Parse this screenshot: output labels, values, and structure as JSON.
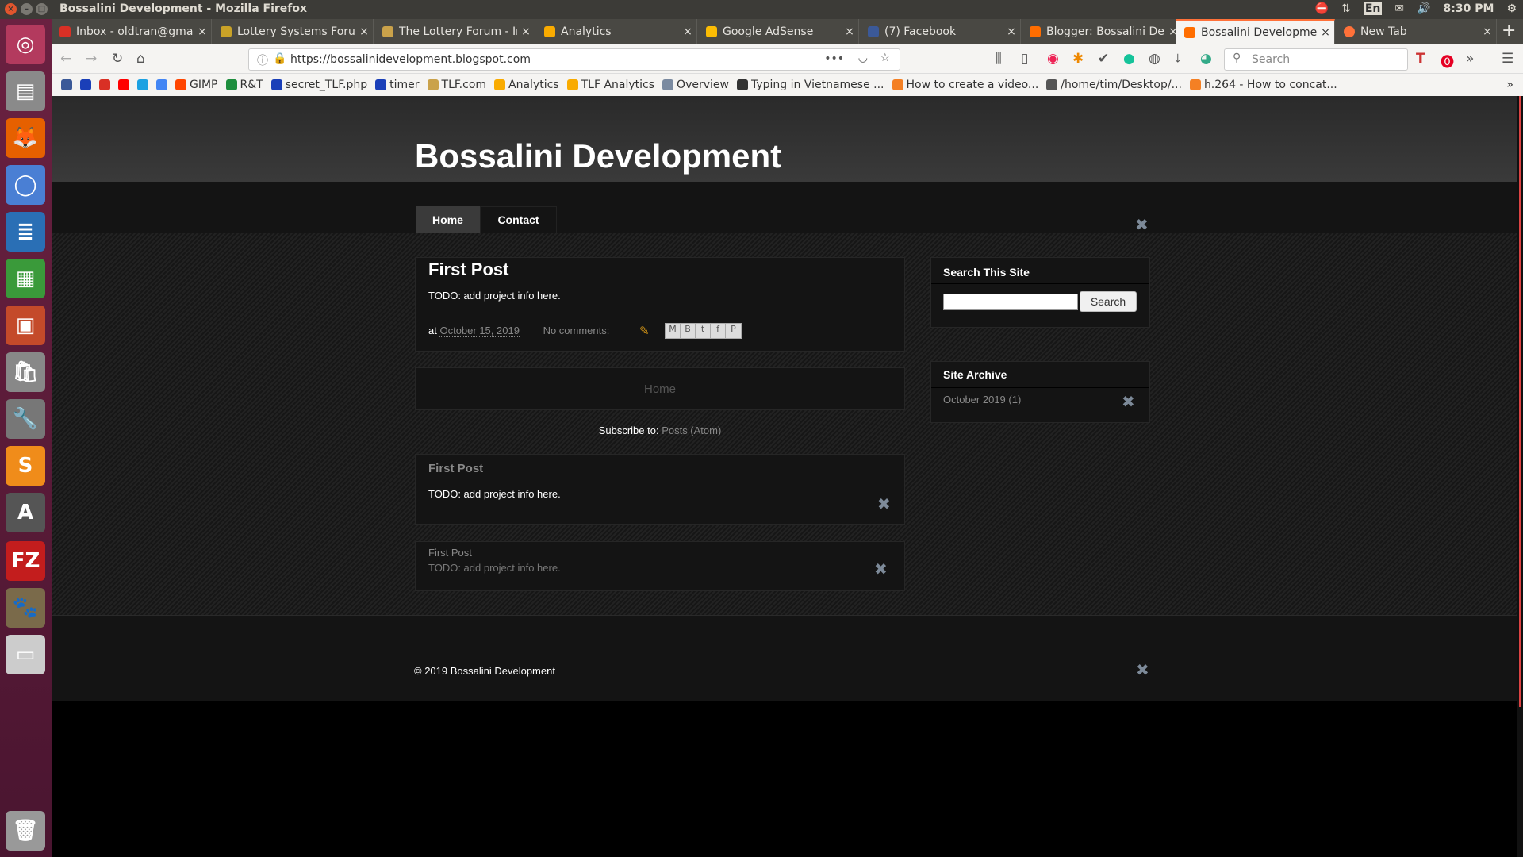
{
  "window": {
    "title": "Bossalini Development - Mozilla Firefox"
  },
  "tray": {
    "lang": "En",
    "time": "8:30 PM"
  },
  "tabs": [
    {
      "label": "Inbox - oldtran@gmail.com",
      "color": "#d93025"
    },
    {
      "label": "Lottery Systems Forum",
      "color": "#c9a227"
    },
    {
      "label": "The Lottery Forum - Index",
      "color": "#caa24a"
    },
    {
      "label": "Analytics",
      "color": "#f9ab00"
    },
    {
      "label": "Google AdSense",
      "color": "#fbbc04"
    },
    {
      "label": "(7) Facebook",
      "color": "#3b5998"
    },
    {
      "label": "Blogger: Bossalini Development",
      "color": "#ff6d00"
    },
    {
      "label": "Bossalini Development",
      "color": "#ff6d00"
    },
    {
      "label": "New Tab",
      "color": "#ff7139"
    }
  ],
  "address": {
    "url": "https://bossalinidevelopment.blogspot.com",
    "search_placeholder": "Search"
  },
  "bookmarks": [
    {
      "label": "",
      "color": "#3b5998"
    },
    {
      "label": "",
      "color": "#1a3fb8"
    },
    {
      "label": "",
      "color": "#d93025"
    },
    {
      "label": "",
      "color": "#ff0000"
    },
    {
      "label": "",
      "color": "#1ba1e2"
    },
    {
      "label": "",
      "color": "#4285f4"
    },
    {
      "label": "GIMP",
      "color": "#ff4500"
    },
    {
      "label": "R&T",
      "color": "#1e8e3e"
    },
    {
      "label": "secret_TLF.php",
      "color": "#1a3fb8"
    },
    {
      "label": "timer",
      "color": "#1a3fb8"
    },
    {
      "label": "TLF.com",
      "color": "#caa24a"
    },
    {
      "label": "Analytics",
      "color": "#f9ab00"
    },
    {
      "label": "TLF Analytics",
      "color": "#f9ab00"
    },
    {
      "label": "Overview",
      "color": "#7a8aa0"
    },
    {
      "label": "Typing in Vietnamese ...",
      "color": "#333"
    },
    {
      "label": "How to create a video...",
      "color": "#f48024"
    },
    {
      "label": "/home/tim/Desktop/...",
      "color": "#555"
    },
    {
      "label": "h.264 - How to concat...",
      "color": "#f48024"
    }
  ],
  "blog": {
    "title": "Bossalini Development",
    "nav": [
      "Home",
      "Contact"
    ],
    "post": {
      "title": "First Post",
      "body": "TODO: add project info here.",
      "at": "at",
      "date": "October 15, 2019",
      "comments": "No comments:",
      "share": [
        "M",
        "B",
        "t",
        "f",
        "P"
      ]
    },
    "pager_home": "Home",
    "subscribe_label": "Subscribe to:",
    "subscribe_link": "Posts (Atom)",
    "popular": {
      "title": "First Post",
      "body": "TODO: add project info here."
    },
    "featured": {
      "title": "First Post",
      "body": "TODO: add project info here."
    },
    "sidebar": {
      "search_title": "Search This Site",
      "search_button": "Search",
      "archive_title": "Site Archive",
      "archive_item": "October 2019",
      "archive_count": "(1)"
    },
    "footer": "© 2019 Bossalini Development"
  }
}
